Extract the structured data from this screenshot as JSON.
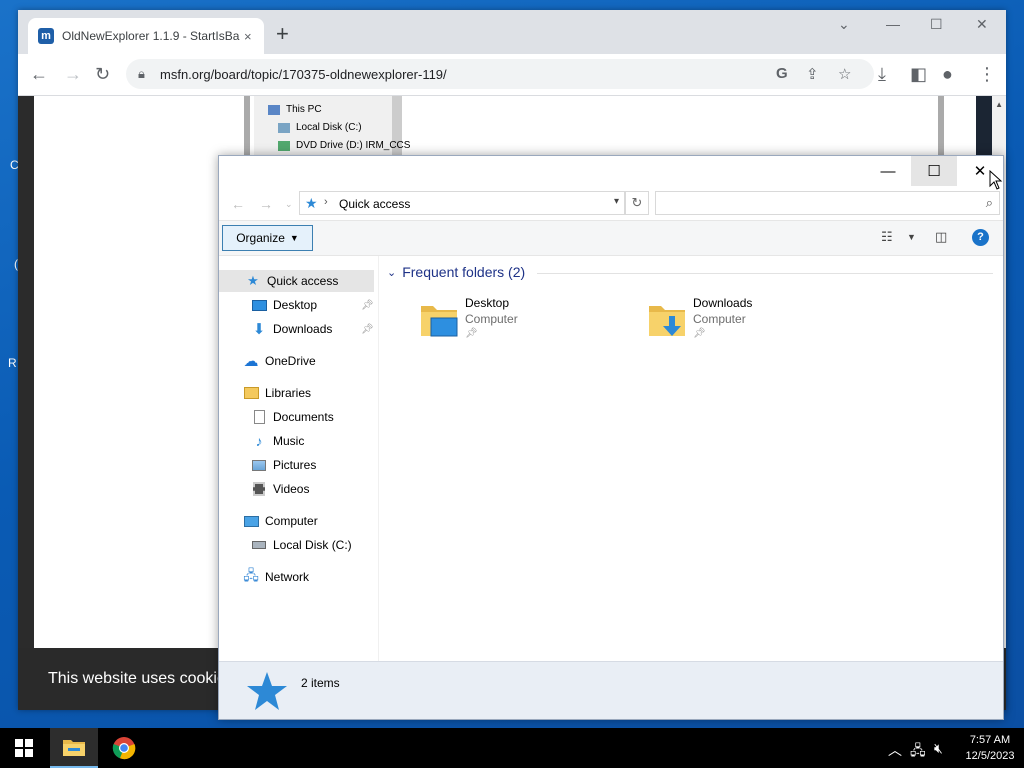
{
  "desktop": {
    "frag1": "C",
    "frag2": "(",
    "frag3": "R"
  },
  "browser": {
    "tab_title": "OldNewExplorer 1.1.9 - StartIsBa",
    "tab_close": "×",
    "newtab": "+",
    "url": "msfn.org/board/topic/170375-oldnewexplorer-119/",
    "favicon_letter": "m",
    "embedded_tree": [
      "This PC",
      "Local Disk (C:)",
      "DVD Drive (D:) IRM_CCS"
    ],
    "cookie_text": "This website uses cookie"
  },
  "explorer": {
    "address_path": "Quick access",
    "organize_label": "Organize",
    "nav": {
      "quick_access": "Quick access",
      "desktop": "Desktop",
      "downloads": "Downloads",
      "onedrive": "OneDrive",
      "libraries": "Libraries",
      "documents": "Documents",
      "music": "Music",
      "pictures": "Pictures",
      "videos": "Videos",
      "computer": "Computer",
      "local_disk": "Local Disk (C:)",
      "network": "Network"
    },
    "group_header": "Frequent folders (2)",
    "folders": [
      {
        "name": "Desktop",
        "location": "Computer"
      },
      {
        "name": "Downloads",
        "location": "Computer"
      }
    ],
    "status_count": "2 items"
  },
  "taskbar": {
    "time": "7:57 AM",
    "date": "12/5/2023"
  },
  "colors": {
    "accent": "#1a73c9",
    "group_header": "#1e3287",
    "folder_yellow": "#f7d26a"
  }
}
